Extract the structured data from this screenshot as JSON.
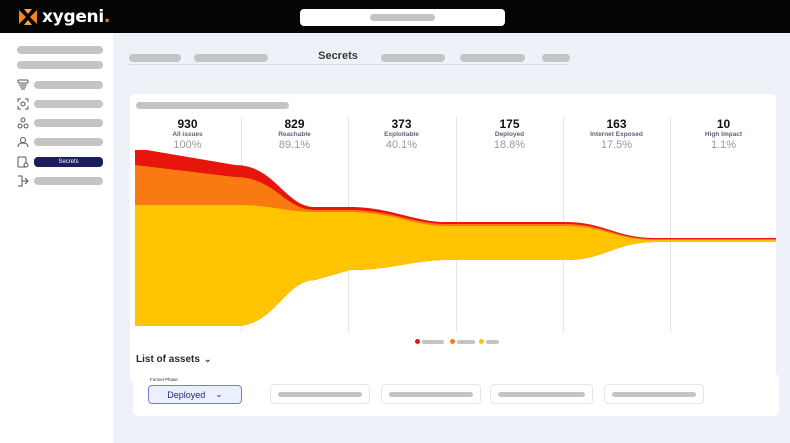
{
  "brand": {
    "name": "xygeni",
    "dot": ".",
    "accent": "#f5821f"
  },
  "sidebar": {
    "items": [
      {
        "icon": "storage-icon",
        "label": ""
      },
      {
        "icon": "scan-icon",
        "label": ""
      },
      {
        "icon": "supply-chain-icon",
        "label": ""
      },
      {
        "icon": "users-icon",
        "label": ""
      },
      {
        "icon": "secrets-icon",
        "label": "Secrets",
        "active": true
      },
      {
        "icon": "pipeline-icon",
        "label": ""
      }
    ]
  },
  "tabs": {
    "active": "Secrets"
  },
  "funnel": {
    "stages": [
      {
        "count": "930",
        "label": "All issues",
        "pct": "100%"
      },
      {
        "count": "829",
        "label": "Reachable",
        "pct": "89.1%"
      },
      {
        "count": "373",
        "label": "Exploitable",
        "pct": "40.1%"
      },
      {
        "count": "175",
        "label": "Deployed",
        "pct": "18.8%"
      },
      {
        "count": "163",
        "label": "Internet Exposed",
        "pct": "17.5%"
      },
      {
        "count": "10",
        "label": "High Impact",
        "pct": "1.1%"
      }
    ],
    "series_colors": [
      "#e8150d",
      "#f97a11",
      "#ffc400"
    ]
  },
  "assets": {
    "title": "List of assets",
    "filter_label": "Funnel Phase",
    "filter_value": "Deployed"
  }
}
